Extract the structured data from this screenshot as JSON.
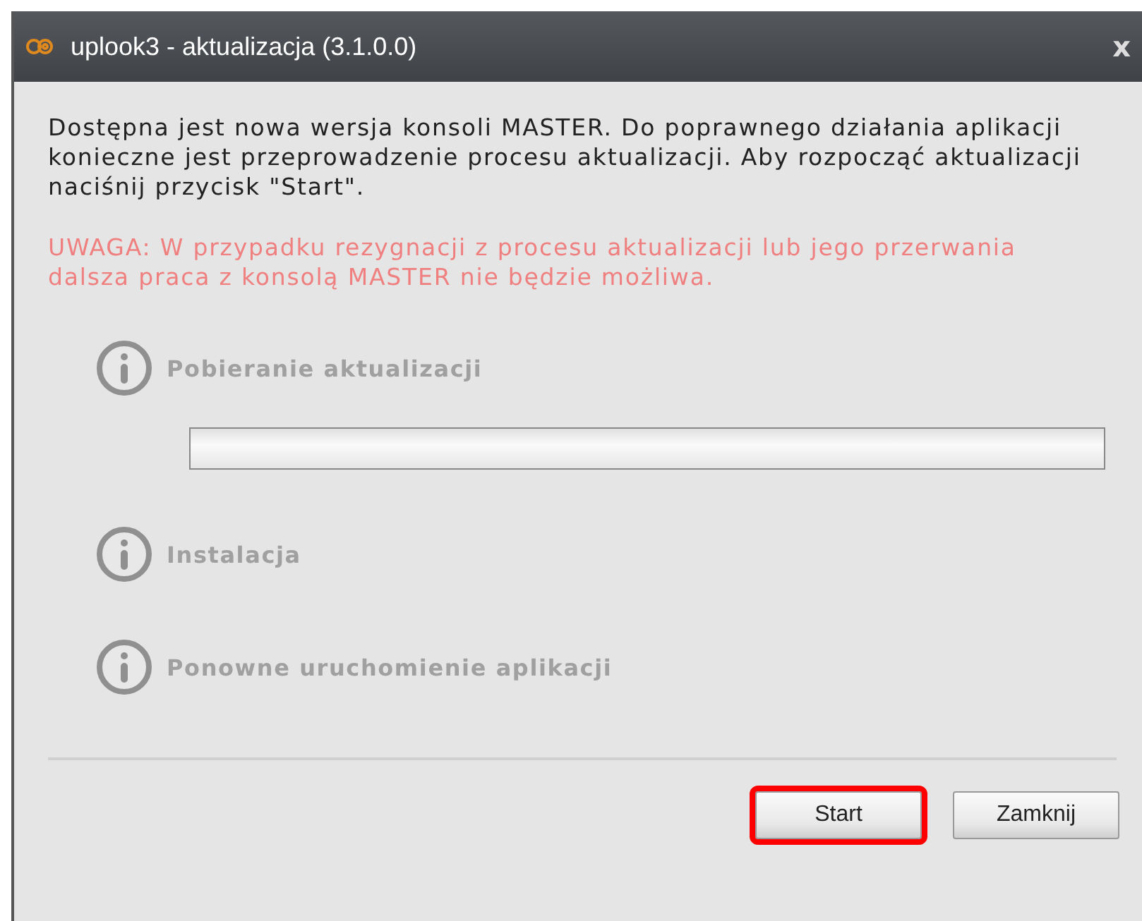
{
  "window": {
    "title": "uplook3 - aktualizacja (3.1.0.0)",
    "close": "x"
  },
  "message": "Dostępna jest nowa wersja konsoli MASTER. Do poprawnego działania aplikacji konieczne jest przeprowadzenie procesu aktualizacji. Aby rozpocząć aktualizacji naciśnij przycisk \"Start\".",
  "warning": "UWAGA: W przypadku rezygnacji z procesu aktualizacji lub jego przerwania dalsza praca z konsolą MASTER nie będzie możliwa.",
  "steps": [
    {
      "label": "Pobieranie aktualizacji",
      "disabled": true,
      "progress": {
        "level": 0
      }
    },
    {
      "label": "Instalacja",
      "disabled": true
    },
    {
      "label": "Ponowne uruchomienie aplikacji",
      "disabled": true
    }
  ],
  "buttons": [
    {
      "label": "Start",
      "highlighted": true
    },
    {
      "label": "Zamknij",
      "highlighted": false
    }
  ]
}
